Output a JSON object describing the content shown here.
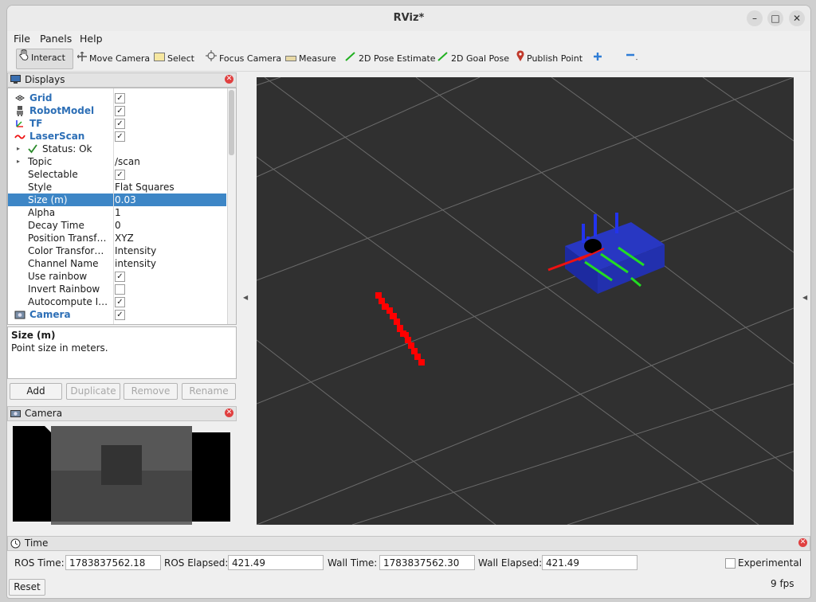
{
  "window": {
    "title": "RViz*"
  },
  "menu": {
    "file": "File",
    "panels": "Panels",
    "help": "Help"
  },
  "toolbar": {
    "interact": "Interact",
    "move_camera": "Move Camera",
    "select": "Select",
    "focus_camera": "Focus Camera",
    "measure": "Measure",
    "pose_estimate": "2D Pose Estimate",
    "goal_pose": "2D Goal Pose",
    "publish_point": "Publish Point"
  },
  "displays": {
    "title": "Displays",
    "rows": [
      {
        "label": "Grid",
        "value": "",
        "checked": true,
        "kind": "display",
        "icon": "grid-icon"
      },
      {
        "label": "RobotModel",
        "value": "",
        "checked": true,
        "kind": "display",
        "icon": "robot-icon"
      },
      {
        "label": "TF",
        "value": "",
        "checked": true,
        "kind": "display",
        "icon": "tf-icon"
      },
      {
        "label": "LaserScan",
        "value": "",
        "checked": true,
        "kind": "display",
        "icon": "laserscan-icon"
      },
      {
        "label": "Status: Ok",
        "value": "",
        "checked": null,
        "kind": "status",
        "icon": "check-icon"
      },
      {
        "label": "Topic",
        "value": "/scan",
        "checked": null,
        "kind": "prop-arrow"
      },
      {
        "label": "Selectable",
        "value": "",
        "checked": true,
        "kind": "prop"
      },
      {
        "label": "Style",
        "value": "Flat Squares",
        "checked": null,
        "kind": "prop"
      },
      {
        "label": "Size (m)",
        "value": "0.03",
        "checked": null,
        "kind": "prop",
        "selected": true
      },
      {
        "label": "Alpha",
        "value": "1",
        "checked": null,
        "kind": "prop"
      },
      {
        "label": "Decay Time",
        "value": "0",
        "checked": null,
        "kind": "prop"
      },
      {
        "label": "Position Transf…",
        "value": "XYZ",
        "checked": null,
        "kind": "prop"
      },
      {
        "label": "Color Transfor…",
        "value": "Intensity",
        "checked": null,
        "kind": "prop"
      },
      {
        "label": "Channel Name",
        "value": "intensity",
        "checked": null,
        "kind": "prop"
      },
      {
        "label": "Use rainbow",
        "value": "",
        "checked": true,
        "kind": "prop"
      },
      {
        "label": "Invert Rainbow",
        "value": "",
        "checked": false,
        "kind": "prop"
      },
      {
        "label": "Autocompute I…",
        "value": "",
        "checked": true,
        "kind": "prop"
      },
      {
        "label": "Camera",
        "value": "",
        "checked": true,
        "kind": "display",
        "icon": "camera-icon"
      }
    ],
    "description_title": "Size (m)",
    "description_text": "Point size in meters.",
    "buttons": {
      "add": "Add",
      "duplicate": "Duplicate",
      "remove": "Remove",
      "rename": "Rename"
    }
  },
  "camera_panel": {
    "title": "Camera"
  },
  "time_panel": {
    "title": "Time",
    "ros_time_label": "ROS Time:",
    "ros_time": "1783837562.18",
    "ros_elapsed_label": "ROS Elapsed:",
    "ros_elapsed": "421.49",
    "wall_time_label": "Wall Time:",
    "wall_time": "1783837562.30",
    "wall_elapsed_label": "Wall Elapsed:",
    "wall_elapsed": "421.49",
    "experimental_label": "Experimental",
    "reset_label": "Reset",
    "fps": "9 fps"
  },
  "colors": {
    "accent": "#3d86c6",
    "display_text": "#2d6fb6",
    "laser": "#ff0000",
    "robot": "#1a2fb0",
    "viewport_bg": "#303030"
  }
}
